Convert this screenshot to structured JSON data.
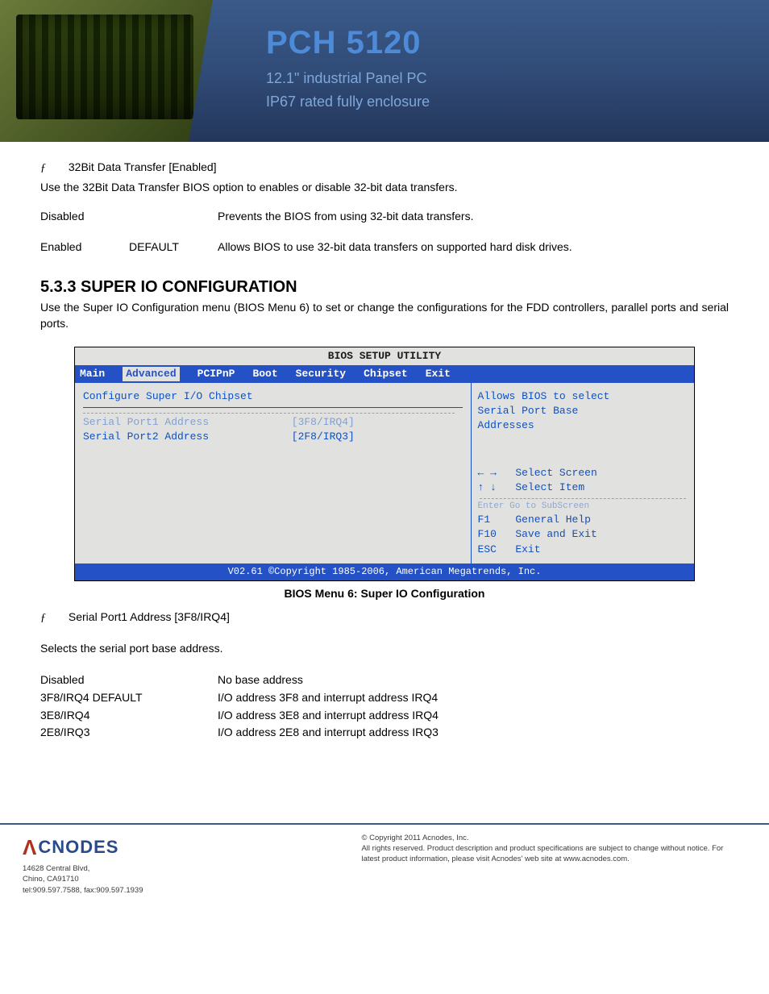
{
  "banner": {
    "title": "PCH 5120",
    "sub1": "12.1\" industrial Panel PC",
    "sub2": "IP67 rated fully enclosure"
  },
  "sec32bit": {
    "bullet": "ƒ",
    "head": "32Bit Data Transfer [Enabled]",
    "desc": "Use the 32Bit Data Transfer BIOS option to enables or disable 32-bit data transfers.",
    "rows": [
      {
        "c1": "Disabled",
        "c2": "",
        "c3": "Prevents the BIOS from using 32-bit data transfers."
      },
      {
        "c1": "Enabled",
        "c2": "DEFAULT",
        "c3": "Allows BIOS to use 32-bit data transfers on supported hard disk drives."
      }
    ]
  },
  "superio": {
    "heading": "5.3.3 SUPER IO CONFIGURATION",
    "para": "Use the Super IO Configuration menu (BIOS Menu 6) to set or change the configurations for the FDD controllers, parallel ports and serial ports."
  },
  "bios": {
    "title": "BIOS SETUP UTILITY",
    "menu": [
      "Main",
      "Advanced",
      "PCIPnP",
      "Boot",
      "Security",
      "Chipset",
      "Exit"
    ],
    "menu_selected": "Advanced",
    "left": {
      "heading": "Configure Super I/O Chipset",
      "row_obscured_k": "Serial Port1 Address",
      "row_obscured_v": "[3F8/IRQ4]",
      "row2_k": "Serial Port2 Address",
      "row2_v": "[2F8/IRQ3]"
    },
    "right": {
      "help1": "Allows BIOS to select",
      "help2": "Serial Port Base",
      "help3": "Addresses",
      "nav1a": "← →",
      "nav1b": "Select Screen",
      "nav2a": "↑ ↓",
      "nav2b": "Select Item",
      "nav_cut": "Enter Go to SubScreen",
      "nav3a": "F1",
      "nav3b": "General Help",
      "nav4a": "F10",
      "nav4b": "Save and Exit",
      "nav5a": "ESC",
      "nav5b": "Exit"
    },
    "foot": "V02.61 ©Copyright 1985-2006, American Megatrends, Inc.",
    "caption": "BIOS Menu 6: Super IO Configuration"
  },
  "serial": {
    "bullet": "ƒ",
    "head": "Serial Port1 Address [3F8/IRQ4]",
    "desc": "Selects the serial port base address.",
    "rows": [
      {
        "c1": "Disabled",
        "c2": "No base address"
      },
      {
        "c1": "3F8/IRQ4  DEFAULT",
        "c2": "I/O address 3F8 and interrupt address IRQ4"
      },
      {
        "c1": "3E8/IRQ4",
        "c2": "I/O address 3E8 and interrupt address IRQ4"
      },
      {
        "c1": "2E8/IRQ3",
        "c2": "I/O address 2E8 and interrupt address IRQ3"
      }
    ]
  },
  "footer": {
    "logo": "CNODES",
    "addr1": "14628 Central Blvd,",
    "addr2": "Chino, CA91710",
    "addr3": "tel:909.597.7588, fax:909.597.1939",
    "r1": "© Copyright 2011 Acnodes, Inc.",
    "r2": "All rights reserved. Product description and product specifications are subject to change without notice. For latest product information, please visit Acnodes' web site at www.acnodes.com."
  }
}
